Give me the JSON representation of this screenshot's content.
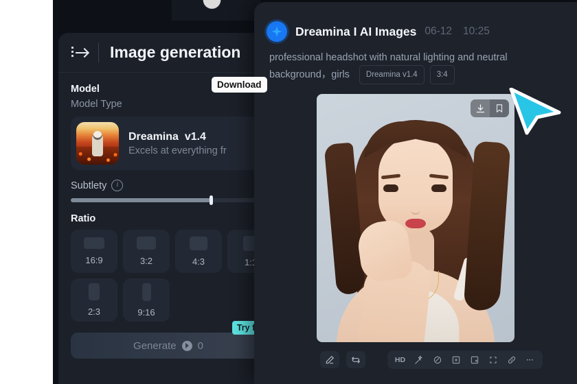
{
  "panel": {
    "collapse_icon": "collapse-sidebar-icon",
    "title": "Image generation",
    "model": {
      "section_title": "Model",
      "section_subtitle": "Model Type",
      "name": "Dreamina",
      "version": "v1.4",
      "description": "Excels at everything fr",
      "thumb_icon": "astronaut-thumbnail"
    },
    "subtlety": {
      "label": "Subtlety",
      "info_icon": "info-icon",
      "value_percent": 72
    },
    "ratio": {
      "section_title": "Ratio",
      "options": [
        {
          "label": "16:9",
          "shape": "r16-9"
        },
        {
          "label": "3:2",
          "shape": "r3-2"
        },
        {
          "label": "4:3",
          "shape": "r4-3"
        },
        {
          "label": "1:1",
          "shape": "r1-1"
        },
        {
          "label": "2:3",
          "shape": "r2-3"
        },
        {
          "label": "9:16",
          "shape": "r9-16"
        }
      ]
    },
    "generate": {
      "label": "Generate",
      "credits": "0",
      "credit_icon": "credit-bolt-icon",
      "badge": "Try free"
    }
  },
  "overlay": {
    "logo_icon": "dreamina-star-logo-icon",
    "title": "Dreamina I AI Images",
    "date": "06-12",
    "time": "10:25",
    "prompt": "professional headshot with natural lighting and neutral background，girls",
    "tags": [
      "Dreamina v1.4",
      "3:4"
    ],
    "image": {
      "alt": "generated-portrait-headshot",
      "actions": [
        {
          "name": "download-icon",
          "highlighted": true
        },
        {
          "name": "bookmark-icon",
          "highlighted": false
        }
      ]
    },
    "tooltip": "Download",
    "cursor_icon": "cursor-arrow",
    "cursor_color": "#29c5e6",
    "toolbar": {
      "left": [
        {
          "name": "edit-pencil-icon"
        },
        {
          "name": "regenerate-icon"
        }
      ],
      "group": [
        {
          "name": "hd-label",
          "label": "HD"
        },
        {
          "name": "magic-wand-icon",
          "label": ""
        },
        {
          "name": "retouch-icon",
          "label": ""
        },
        {
          "name": "inpaint-icon",
          "label": ""
        },
        {
          "name": "expand-canvas-icon",
          "label": ""
        },
        {
          "name": "crop-icon",
          "label": ""
        },
        {
          "name": "link-icon",
          "label": ""
        },
        {
          "name": "more-options-icon",
          "label": "···"
        }
      ]
    }
  },
  "colors": {
    "accent": "#5de3e0",
    "brand_blue": "#1877f2",
    "cursor": "#29c5e6",
    "panel_bg": "#1b2029",
    "overlay_bg": "#1d222b"
  }
}
